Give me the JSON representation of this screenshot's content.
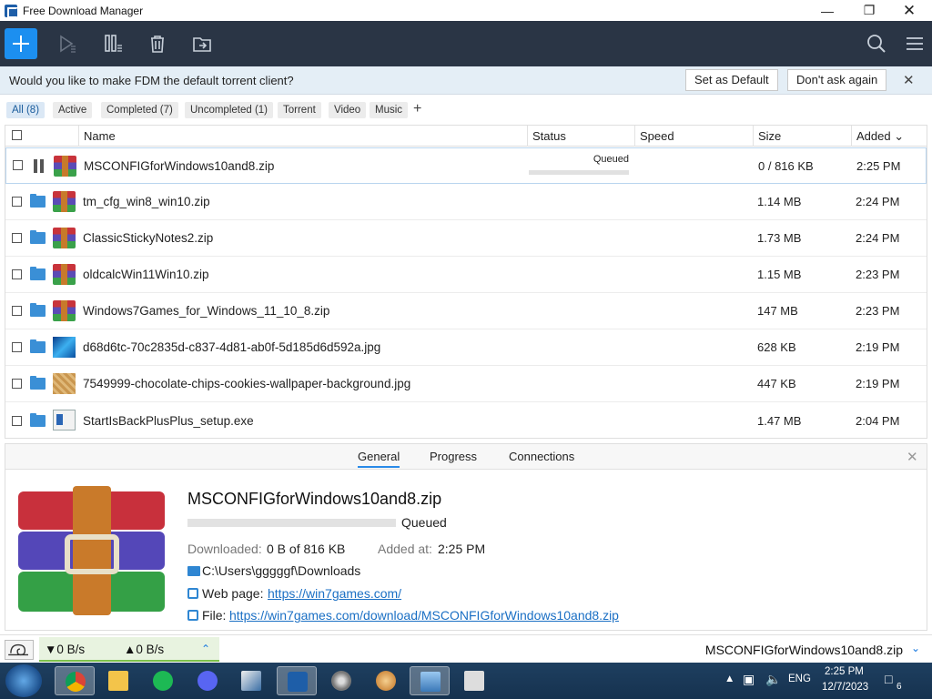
{
  "window": {
    "title": "Free Download Manager"
  },
  "notification": {
    "message": "Would you like to make FDM the default torrent client?",
    "set_default": "Set as Default",
    "dont_ask": "Don't ask again",
    "close": "✕"
  },
  "filters": [
    {
      "label": "All (8)",
      "active": true
    },
    {
      "label": "Active"
    },
    {
      "label": "Completed (7)"
    },
    {
      "label": "Uncompleted (1)"
    },
    {
      "label": "Torrent"
    },
    {
      "label": "Video"
    },
    {
      "label": "Music"
    }
  ],
  "filter_add": "+",
  "table": {
    "columns": {
      "name": "Name",
      "status": "Status",
      "speed": "Speed",
      "size": "Size",
      "added": "Added ⌄"
    },
    "rows": [
      {
        "name": "MSCONFIGforWindows10and8.zip",
        "status": "Queued",
        "size": "0 / 816 KB",
        "added": "2:25 PM",
        "icon": "rar-icon",
        "paused": true
      },
      {
        "name": "tm_cfg_win8_win10.zip",
        "size": "1.14 MB",
        "added": "2:24 PM",
        "icon": "rar-icon"
      },
      {
        "name": "ClassicStickyNotes2.zip",
        "size": "1.73 MB",
        "added": "2:24 PM",
        "icon": "rar-icon"
      },
      {
        "name": "oldcalcWin11Win10.zip",
        "size": "1.15 MB",
        "added": "2:23 PM",
        "icon": "rar-icon"
      },
      {
        "name": "Windows7Games_for_Windows_11_10_8.zip",
        "size": "147 MB",
        "added": "2:23 PM",
        "icon": "rar-icon"
      },
      {
        "name": "d68d6tc-70c2835d-c837-4d81-ab0f-5d185d6d592a.jpg",
        "size": "628 KB",
        "added": "2:19 PM",
        "icon": "image-icon"
      },
      {
        "name": "7549999-chocolate-chips-cookies-wallpaper-background.jpg",
        "size": "447 KB",
        "added": "2:19 PM",
        "icon": "image-icon"
      },
      {
        "name": "StartIsBackPlusPlus_setup.exe",
        "size": "1.47 MB",
        "added": "2:04 PM",
        "icon": "exe-icon"
      }
    ]
  },
  "details": {
    "tabs": [
      "General",
      "Progress",
      "Connections"
    ],
    "name": "MSCONFIGforWindows10and8.zip",
    "status": "Queued",
    "downloaded_label": "Downloaded:",
    "downloaded_value": "0 B of 816 KB",
    "added_label": "Added at:",
    "added_value": "2:25 PM",
    "folder": "C:\\Users\\gggggf\\Downloads",
    "webpage_label": "Web page:",
    "webpage": "https://win7games.com/",
    "file_label": "File:",
    "file": "https://win7games.com/download/MSCONFIGforWindows10and8.zip"
  },
  "statusbar": {
    "download_speed": "▼0 B/s",
    "upload_speed": "▲0 B/s",
    "current": "MSCONFIGforWindows10and8.zip"
  },
  "taskbar": {
    "lang": "ENG",
    "time": "2:25 PM",
    "date": "12/7/2023",
    "notifications": "6"
  }
}
